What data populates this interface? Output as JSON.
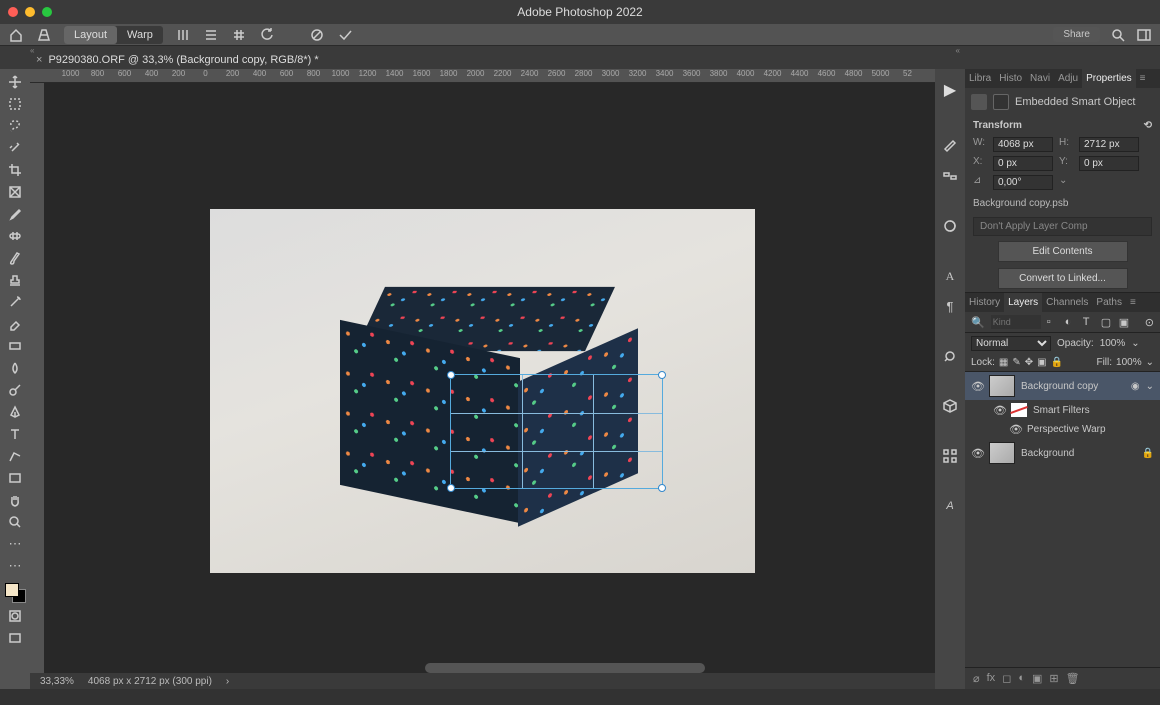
{
  "app_title": "Adobe Photoshop 2022",
  "options": {
    "layout": "Layout",
    "warp": "Warp",
    "share": "Share"
  },
  "doc_tab": "P9290380.ORF @ 33,3% (Background copy, RGB/8*) *",
  "ruler_h": [
    "",
    "1000",
    "800",
    "600",
    "400",
    "200",
    "0",
    "200",
    "400",
    "600",
    "800",
    "1000",
    "1200",
    "1400",
    "1600",
    "1800",
    "2000",
    "2200",
    "2400",
    "2600",
    "2800",
    "3000",
    "3200",
    "3400",
    "3600",
    "3800",
    "4000",
    "4200",
    "4400",
    "4600",
    "4800",
    "5000",
    "52"
  ],
  "status": {
    "zoom": "33,33%",
    "dims": "4068 px x 2712 px (300 ppi)"
  },
  "top_tabs": [
    "Libra",
    "Histo",
    "Navi",
    "Adju",
    "Properties"
  ],
  "properties": {
    "type": "Embedded Smart Object",
    "section": "Transform",
    "w": "4068 px",
    "h": "2712 px",
    "x": "0 px",
    "y": "0 px",
    "angle": "0,00°",
    "file": "Background copy.psb",
    "layercomp": "Don't Apply Layer Comp",
    "edit_btn": "Edit Contents",
    "convert_btn": "Convert to Linked..."
  },
  "layer_tabs": [
    "History",
    "Layers",
    "Channels",
    "Paths"
  ],
  "layers": {
    "search_ph": "Kind",
    "blend": "Normal",
    "opacity_lbl": "Opacity:",
    "opacity": "100%",
    "lock_lbl": "Lock:",
    "fill_lbl": "Fill:",
    "fill": "100%",
    "items": [
      {
        "name": "Background copy"
      },
      {
        "name": "Smart Filters"
      },
      {
        "name": "Perspective Warp"
      },
      {
        "name": "Background"
      }
    ]
  }
}
